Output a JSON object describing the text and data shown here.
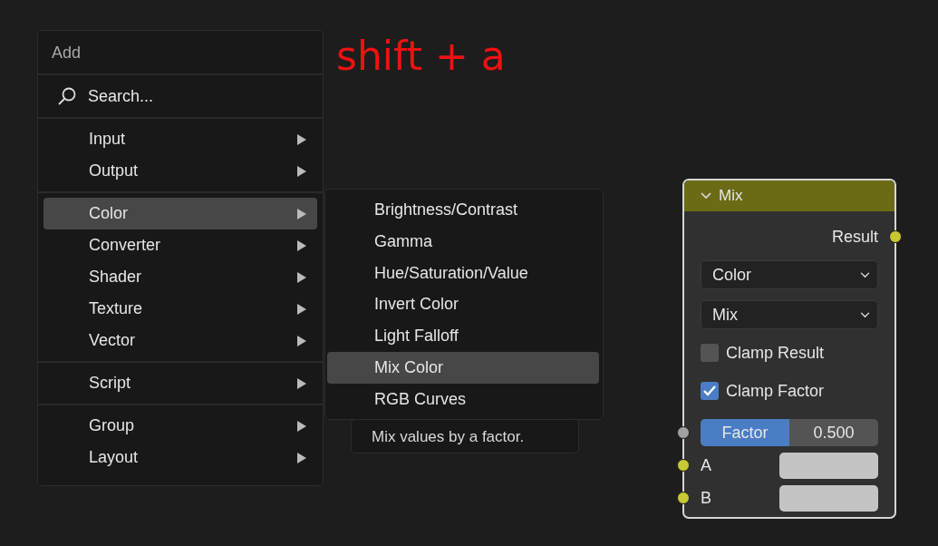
{
  "annotation": "shift + a",
  "menu": {
    "title": "Add",
    "search": {
      "placeholder": "Search..."
    },
    "groups": [
      [
        {
          "label": "Input",
          "selected": false
        },
        {
          "label": "Output",
          "selected": false
        }
      ],
      [
        {
          "label": "Color",
          "selected": true
        },
        {
          "label": "Converter",
          "selected": false
        },
        {
          "label": "Shader",
          "selected": false
        },
        {
          "label": "Texture",
          "selected": false
        },
        {
          "label": "Vector",
          "selected": false
        }
      ],
      [
        {
          "label": "Script",
          "selected": false
        }
      ],
      [
        {
          "label": "Group",
          "selected": false
        },
        {
          "label": "Layout",
          "selected": false
        }
      ]
    ]
  },
  "submenu": {
    "items": [
      {
        "label": "Brightness/Contrast",
        "selected": false
      },
      {
        "label": "Gamma",
        "selected": false
      },
      {
        "label": "Hue/Saturation/Value",
        "selected": false
      },
      {
        "label": "Invert Color",
        "selected": false
      },
      {
        "label": "Light Falloff",
        "selected": false
      },
      {
        "label": "Mix Color",
        "selected": true
      },
      {
        "label": "RGB Curves",
        "selected": false
      }
    ]
  },
  "tooltip": "Mix values by a factor.",
  "node": {
    "title": "Mix",
    "expanded": true,
    "output": {
      "label": "Result",
      "color": "#c8c832"
    },
    "dropdowns": [
      "Color",
      "Mix"
    ],
    "checkboxes": [
      {
        "label": "Clamp Result",
        "checked": false
      },
      {
        "label": "Clamp Factor",
        "checked": true
      }
    ],
    "factor": {
      "label": "Factor",
      "value": "0.500",
      "level": 0.5,
      "color": "#a1a1a1"
    },
    "inputs": [
      {
        "label": "A",
        "color": "#c8c832"
      },
      {
        "label": "B",
        "color": "#c8c832"
      }
    ]
  }
}
